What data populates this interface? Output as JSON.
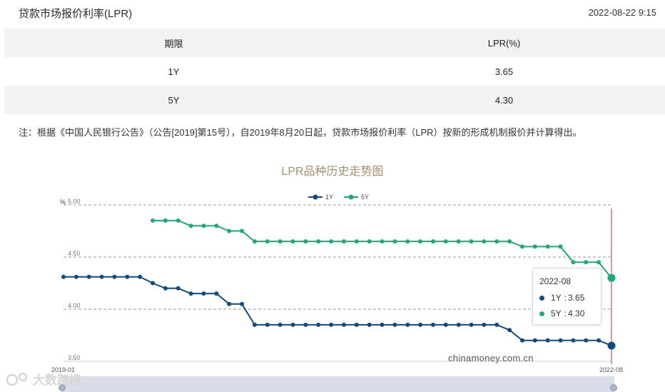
{
  "header": {
    "title": "贷款市场报价利率(LPR)",
    "datetime": "2022-08-22 9:15"
  },
  "table": {
    "headers": [
      "期限",
      "LPR(%)"
    ],
    "rows": [
      {
        "term": "1Y",
        "rate": "3.65"
      },
      {
        "term": "5Y",
        "rate": "4.30"
      }
    ]
  },
  "note": "注：根据《中国人民银行公告》（公告[2019]第15号），自2019年8月20日起，贷款市场报价利率（LPR）按新的形成机制报价并计算得出。",
  "chart_data": {
    "type": "line",
    "title": "LPR品种历史走势图",
    "ylabel": "%",
    "ylim": [
      3.5,
      5.0
    ],
    "yticks": [
      "3.50",
      "4.00",
      "4.50",
      "5.00"
    ],
    "x_start_label": "2019-01",
    "x_end_label": "2022-08",
    "grid": "horizontal-dashed",
    "legend_position": "top-center",
    "x": [
      "2019-01",
      "2019-02",
      "2019-03",
      "2019-04",
      "2019-05",
      "2019-06",
      "2019-07",
      "2019-08",
      "2019-09",
      "2019-10",
      "2019-11",
      "2019-12",
      "2020-01",
      "2020-02",
      "2020-03",
      "2020-04",
      "2020-05",
      "2020-06",
      "2020-07",
      "2020-08",
      "2020-09",
      "2020-10",
      "2020-11",
      "2020-12",
      "2021-01",
      "2021-02",
      "2021-03",
      "2021-04",
      "2021-05",
      "2021-06",
      "2021-07",
      "2021-08",
      "2021-09",
      "2021-10",
      "2021-11",
      "2021-12",
      "2022-01",
      "2022-02",
      "2022-03",
      "2022-04",
      "2022-05",
      "2022-06",
      "2022-07",
      "2022-08"
    ],
    "series": [
      {
        "name": "1Y",
        "color": "#0f4b86",
        "values": [
          4.31,
          4.31,
          4.31,
          4.31,
          4.31,
          4.31,
          4.31,
          4.25,
          4.2,
          4.2,
          4.15,
          4.15,
          4.15,
          4.05,
          4.05,
          3.85,
          3.85,
          3.85,
          3.85,
          3.85,
          3.85,
          3.85,
          3.85,
          3.85,
          3.85,
          3.85,
          3.85,
          3.85,
          3.85,
          3.85,
          3.85,
          3.85,
          3.85,
          3.85,
          3.85,
          3.8,
          3.7,
          3.7,
          3.7,
          3.7,
          3.7,
          3.7,
          3.7,
          3.65
        ]
      },
      {
        "name": "5Y",
        "color": "#1aac7a",
        "values": [
          null,
          null,
          null,
          null,
          null,
          null,
          null,
          4.85,
          4.85,
          4.85,
          4.8,
          4.8,
          4.8,
          4.75,
          4.75,
          4.65,
          4.65,
          4.65,
          4.65,
          4.65,
          4.65,
          4.65,
          4.65,
          4.65,
          4.65,
          4.65,
          4.65,
          4.65,
          4.65,
          4.65,
          4.65,
          4.65,
          4.65,
          4.65,
          4.65,
          4.65,
          4.6,
          4.6,
          4.6,
          4.6,
          4.45,
          4.45,
          4.45,
          4.3
        ]
      }
    ]
  },
  "tooltip": {
    "date": "2022-08",
    "rows": [
      {
        "name": "1Y",
        "sep": ":",
        "value": "3.65"
      },
      {
        "name": "5Y",
        "sep": ":",
        "value": "4.30"
      }
    ]
  },
  "watermark": "chinamoney.com.cn",
  "brand": "大数跨境"
}
